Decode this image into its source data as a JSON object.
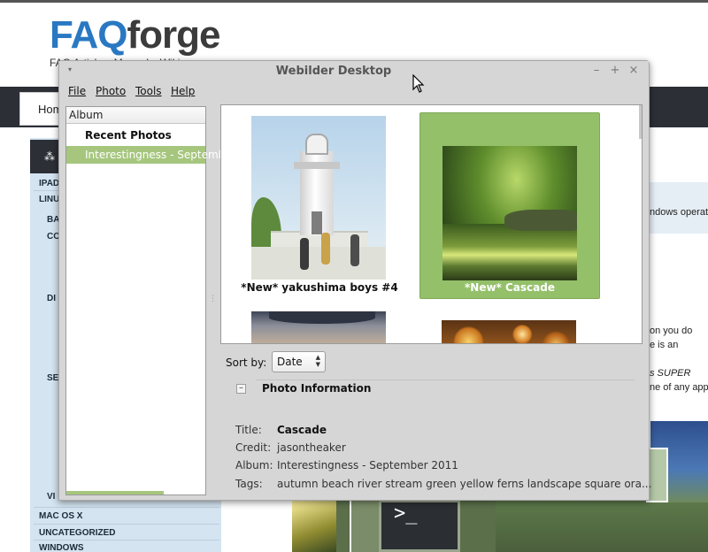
{
  "website": {
    "logo_faq": "FAQ",
    "logo_forge": "forge",
    "tagline": "FAQ Articles, Manuals, Wiki",
    "nav_home": "Home",
    "sidebar_items": [
      "IPAD",
      "LINUX",
      "BA",
      "CO",
      "DI",
      "SE",
      "VI",
      "MAC OS X",
      "UNCATEGORIZED",
      "WINDOWS"
    ],
    "right_snippets": [
      "ndows operat",
      "on you do",
      "e is an",
      "s SUPER",
      "ne of any app"
    ]
  },
  "window": {
    "title": "Webilder Desktop",
    "controls": {
      "minimize": "–",
      "maximize": "+",
      "close": "×"
    },
    "menu": [
      "File",
      "Photo",
      "Tools",
      "Help"
    ]
  },
  "album": {
    "header": "Album",
    "items": [
      {
        "label": "Recent Photos",
        "selected": false
      },
      {
        "label": "Interestingness - September 2011",
        "selected": true
      }
    ]
  },
  "photos": [
    {
      "caption": "*New* yakushima boys #4",
      "selected": false,
      "image": "lighthouse-photo"
    },
    {
      "caption": "*New* Cascade",
      "selected": true,
      "image": "forest-stream-photo"
    },
    {
      "caption": "",
      "selected": false,
      "image": "cap-portrait-photo"
    },
    {
      "caption": "",
      "selected": false,
      "image": "bokeh-lights-photo"
    }
  ],
  "sort": {
    "label": "Sort by:",
    "value": "Date"
  },
  "info": {
    "toggle": "–",
    "heading": "Photo Information",
    "title_label": "Title:",
    "title_value": "Cascade",
    "credit_label": "Credit:",
    "credit_value": "jasontheaker",
    "album_label": "Album:",
    "album_value": "Interestingness - September 2011",
    "tags_label": "Tags:",
    "tags_value": "autumn beach river stream green yellow ferns landscape square ora..."
  },
  "colors": {
    "selection": "#94c06a",
    "logo_blue": "#2a78c2",
    "nav_dark": "#2c2f36"
  }
}
